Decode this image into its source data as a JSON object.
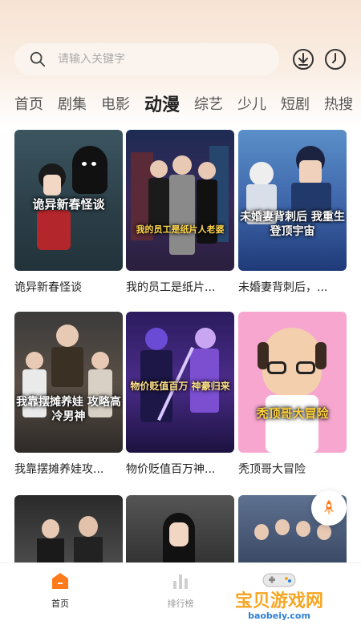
{
  "search": {
    "placeholder": "请输入关键字"
  },
  "header": {
    "download_icon": "download-icon",
    "history_icon": "clock-icon"
  },
  "tabs": [
    {
      "label": "首页"
    },
    {
      "label": "剧集"
    },
    {
      "label": "电影"
    },
    {
      "label": "动漫",
      "active": true
    },
    {
      "label": "综艺"
    },
    {
      "label": "少儿"
    },
    {
      "label": "短剧"
    },
    {
      "label": "热搜"
    }
  ],
  "cards": [
    {
      "title": "诡异新春怪谈",
      "art": "诡异新春怪谈"
    },
    {
      "title": "我的员工是纸片...",
      "art": "我的员工是纸片人老婆"
    },
    {
      "title": "未婚妻背刺后，...",
      "art": "未婚妻背刺后 我重生登顶宇宙"
    },
    {
      "title": "我靠摆摊养娃攻...",
      "art": "我靠摆摊养娃 攻略高冷男神"
    },
    {
      "title": "物价贬值百万神...",
      "art": "物价贬值百万 神豪归来"
    },
    {
      "title": "秃顶哥大冒险",
      "art": "秃顶哥大冒险"
    },
    {
      "title": "",
      "art": ""
    },
    {
      "title": "",
      "art": ""
    },
    {
      "title": "",
      "art": ""
    }
  ],
  "nav": {
    "home_label": "首页",
    "rank_label": "排行榜"
  },
  "watermark": {
    "text": "宝贝游戏网",
    "url": "baobeiy.com"
  },
  "colors": {
    "accent": "#ff7a1a",
    "header_bg": "#f7e3d3",
    "watermark": "#f5a623"
  }
}
